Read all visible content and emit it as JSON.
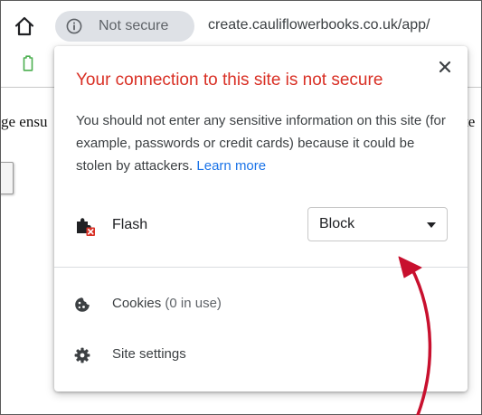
{
  "toolbar": {
    "home_icon": "home-icon",
    "security_chip": {
      "icon": "info-icon",
      "label": "Not secure"
    },
    "url": "create.cauliflowerbooks.co.uk/app/"
  },
  "bookmarks": {
    "icon": "bookmark-icon",
    "icon_color": "#4caf50"
  },
  "page": {
    "left_fragment": "ge ensu",
    "right_fragment": "te"
  },
  "popup": {
    "title": "Your connection to this site is not secure",
    "title_color": "#d93025",
    "body": "You should not enter any sensitive information on this site (for example, passwords or credit cards) because it could be stolen by attackers.",
    "learn_more": "Learn more",
    "link_color": "#1a73e8",
    "close_icon": "close-icon",
    "permission": {
      "icon": "puzzle-icon",
      "label": "Flash",
      "selected_value": "Block"
    },
    "cookies": {
      "icon": "cookie-icon",
      "label": "Cookies",
      "count": "(0 in use)"
    },
    "site_settings": {
      "icon": "gear-icon",
      "label": "Site settings"
    }
  },
  "annotation": {
    "arrow_color": "#c8102e"
  }
}
